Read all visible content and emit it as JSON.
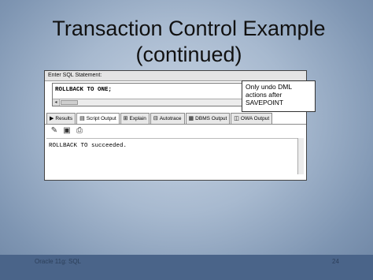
{
  "slide": {
    "title_line1": "Transaction Control Example",
    "title_line2": "(continued)"
  },
  "sql_window": {
    "header": "Enter SQL Statement:",
    "statement": "ROLLBACK TO ONE;",
    "tabs": [
      {
        "label": "Results",
        "icon": "results-icon",
        "active": false
      },
      {
        "label": "Script Output",
        "icon": "script-output-icon",
        "active": true
      },
      {
        "label": "Explain",
        "icon": "explain-icon",
        "active": false
      },
      {
        "label": "Autotrace",
        "icon": "autotrace-icon",
        "active": false
      },
      {
        "label": "DBMS Output",
        "icon": "dbms-output-icon",
        "active": false
      },
      {
        "label": "OWA Output",
        "icon": "owa-output-icon",
        "active": false
      }
    ],
    "toolbar_icons": [
      "eraser-icon",
      "save-icon",
      "print-icon"
    ],
    "output_text": "ROLLBACK TO succeeded."
  },
  "callout": {
    "line1": "Only undo DML",
    "line2": "actions after",
    "line3": "SAVEPOINT"
  },
  "footer": {
    "left": "Oracle 11g: SQL",
    "right": "24"
  },
  "colors": {
    "footer_bar": "#4a6489",
    "background_center": "#c9d5e4",
    "background_edge": "#6d84a3"
  }
}
